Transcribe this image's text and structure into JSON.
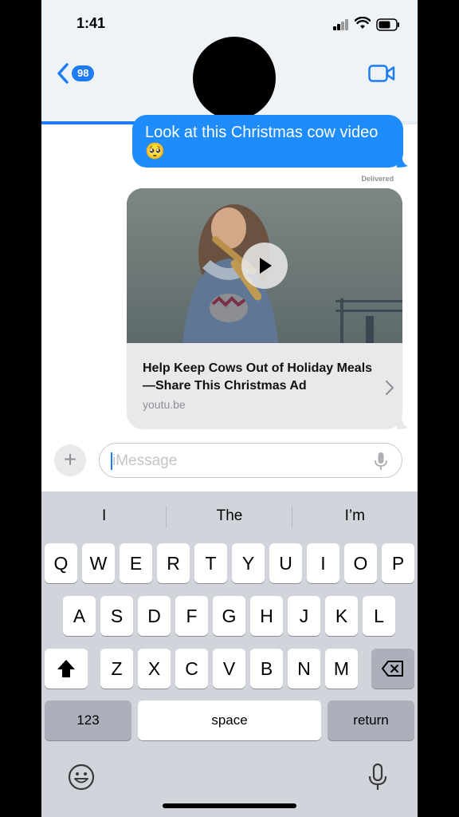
{
  "status": {
    "time": "1:41"
  },
  "header": {
    "unread_badge": "98"
  },
  "conversation": {
    "progress": 0.48,
    "sent_message": "Look at this Christmas cow video 🥺",
    "delivered_label": "Delivered",
    "link_preview": {
      "title": "Help Keep Cows Out of Holiday Meals—Share This Christmas Ad",
      "domain": "youtu.be"
    }
  },
  "composer": {
    "placeholder": "iMessage"
  },
  "keyboard": {
    "suggestions": [
      "I",
      "The",
      "I’m"
    ],
    "row1": [
      "Q",
      "W",
      "E",
      "R",
      "T",
      "Y",
      "U",
      "I",
      "O",
      "P"
    ],
    "row2": [
      "A",
      "S",
      "D",
      "F",
      "G",
      "H",
      "J",
      "K",
      "L"
    ],
    "row3": [
      "Z",
      "X",
      "C",
      "V",
      "B",
      "N",
      "M"
    ],
    "numbers_label": "123",
    "space_label": "space",
    "return_label": "return"
  },
  "colors": {
    "accent": "#1e7cf2",
    "bubble": "#1e8cfb",
    "keyboard_bg": "#d1d4da"
  }
}
